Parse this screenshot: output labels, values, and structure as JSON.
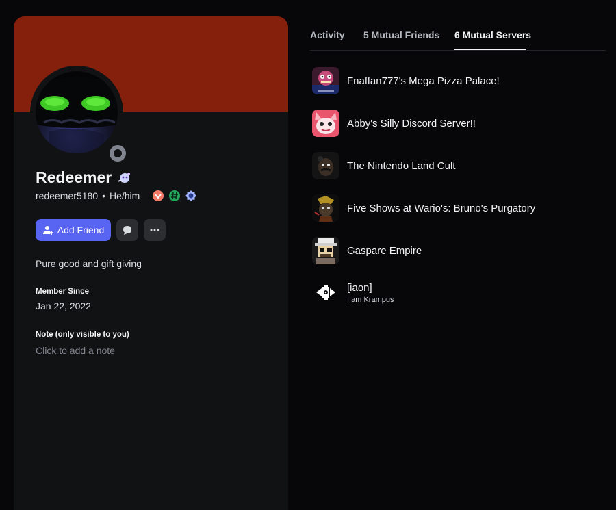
{
  "profile": {
    "display_name": "Redeemer",
    "username": "redeemer5180",
    "separator": "•",
    "pronouns": "He/him",
    "bio": "Pure good and gift giving",
    "member_since_label": "Member Since",
    "member_since_value": "Jan 22, 2022",
    "note_label": "Note (only visible to you)",
    "note_placeholder": "Click to add a note",
    "banner_color": "#85200c",
    "status": "offline"
  },
  "actions": {
    "add_friend_label": "Add Friend",
    "add_friend_color": "#5865f2"
  },
  "tabs": [
    {
      "label": "Activity",
      "active": false
    },
    {
      "label": "5 Mutual Friends",
      "active": false
    },
    {
      "label": "6 Mutual Servers",
      "active": true
    }
  ],
  "servers": [
    {
      "name": "Fnaffan777's Mega Pizza Palace!",
      "subtitle": ""
    },
    {
      "name": "Abby's Silly Discord Server!!",
      "subtitle": ""
    },
    {
      "name": "The Nintendo Land Cult",
      "subtitle": ""
    },
    {
      "name": "Five Shows at Wario's: Bruno's Purgatory",
      "subtitle": ""
    },
    {
      "name": "Gaspare Empire",
      "subtitle": ""
    },
    {
      "name": "[iaon]",
      "subtitle": "I am Krampus"
    }
  ]
}
